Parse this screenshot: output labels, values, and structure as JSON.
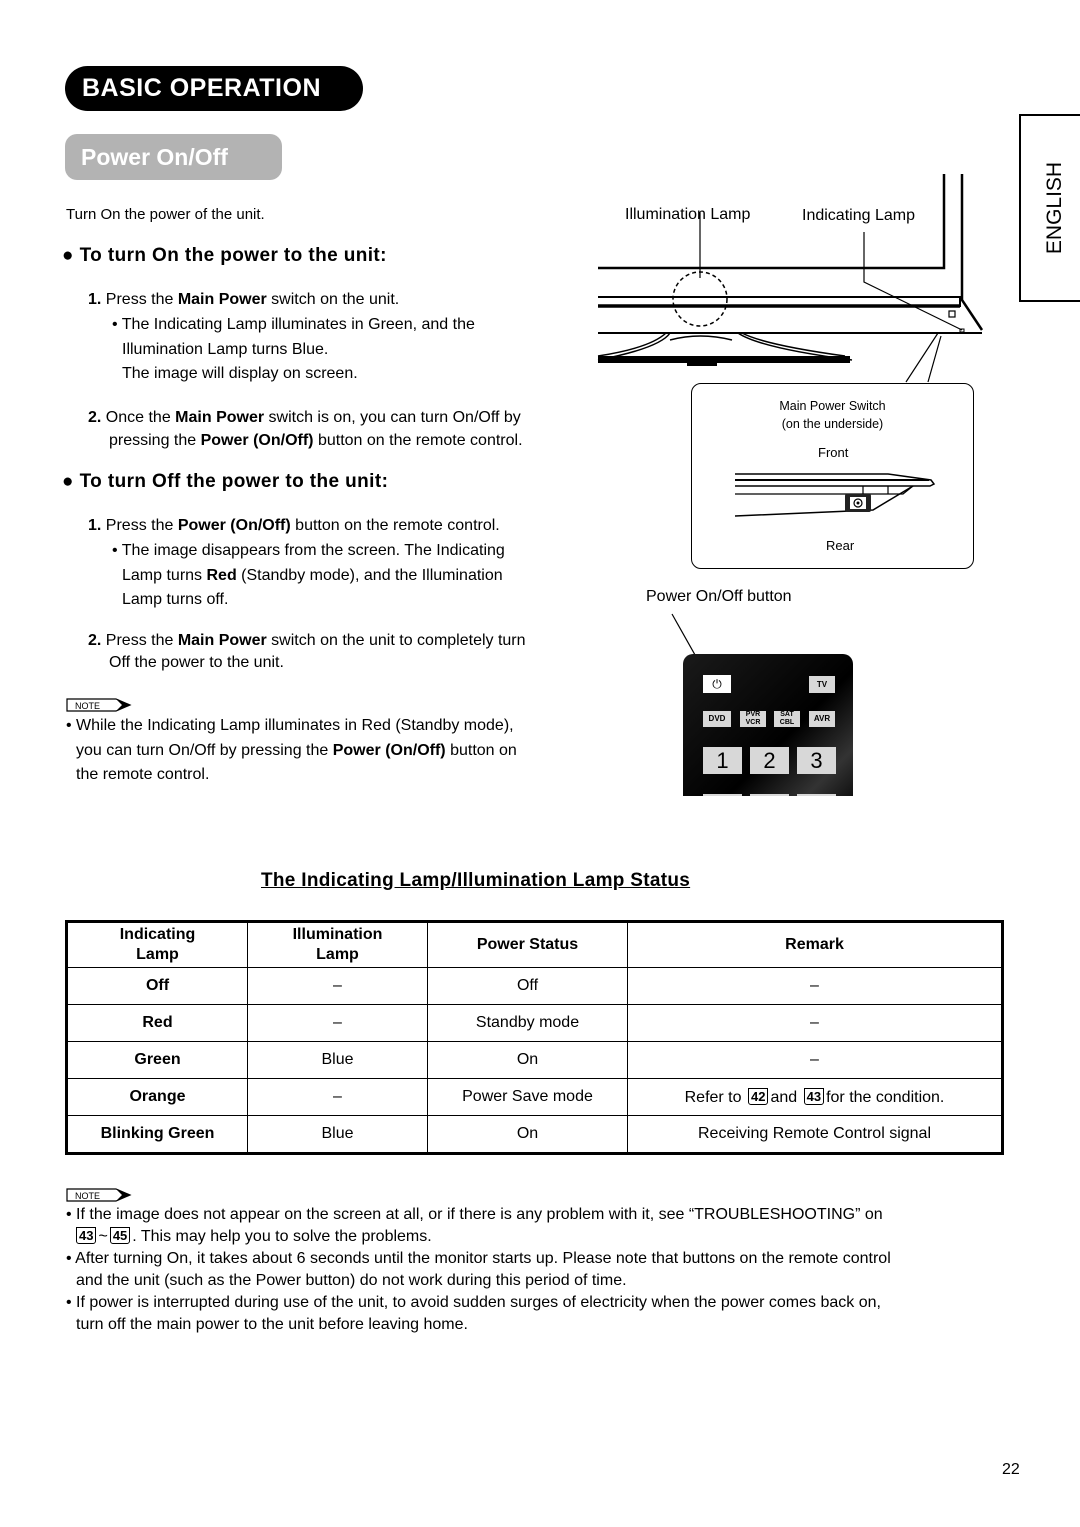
{
  "header": {
    "section_title": "BASIC OPERATION",
    "subsection_title": "Power On/Off",
    "language_tab": "ENGLISH"
  },
  "intro": "Turn On the power of the unit.",
  "turn_on": {
    "heading": "To turn On the power to the unit:",
    "step1_num": "1.",
    "step1_pre": "Press the ",
    "step1_bold": "Main Power",
    "step1_post": " switch on the unit.",
    "step1_bullet_line1": "The Indicating Lamp illuminates in Green, and the",
    "step1_bullet_line2": "Illumination Lamp turns Blue.",
    "step1_bullet_line3": "The image will display on screen.",
    "step2_num": "2.",
    "step2_pre": "Once the ",
    "step2_bold1": "Main Power",
    "step2_mid": " switch is on, you can turn On/Off by",
    "step2_line2_pre": "pressing the ",
    "step2_bold2": "Power (On/Off)",
    "step2_line2_post": " button on the remote control."
  },
  "turn_off": {
    "heading": "To turn Off the power to the unit:",
    "step1_num": "1.",
    "step1_pre": "Press the ",
    "step1_bold": "Power (On/Off)",
    "step1_post": " button on the remote control.",
    "step1_bullet_line1": "The image disappears from the screen. The Indicating",
    "step1_bullet_line2_pre": "Lamp turns ",
    "step1_bullet_line2_bold": "Red",
    "step1_bullet_line2_post": " (Standby mode), and the Illumination",
    "step1_bullet_line3": "Lamp turns off.",
    "step2_num": "2.",
    "step2_pre": "Press the ",
    "step2_bold": "Main Power",
    "step2_post": " switch on the unit to completely turn",
    "step2_line2": "Off the power to the unit."
  },
  "note1": {
    "tag": "NOTE",
    "line1": "While the Indicating Lamp illuminates in Red (Standby mode),",
    "line2_pre": "you can turn On/Off by pressing the ",
    "line2_bold": "Power (On/Off)",
    "line2_post": " button on",
    "line3": "the remote control."
  },
  "diagram": {
    "illumination_lamp_label": "Illumination Lamp",
    "indicating_lamp_label": "Indicating Lamp",
    "callout_title_line1": "Main Power Switch",
    "callout_title_line2": "(on the underside)",
    "front_label": "Front",
    "rear_label": "Rear",
    "remote_label": "Power On/Off button",
    "remote_buttons": {
      "power": "⏻",
      "tv": "TV",
      "dvd": "DVD",
      "pvr_vcr": "PVR VCR",
      "sat_cbl": "SAT CBL",
      "avr": "AVR",
      "n1": "1",
      "n2": "2",
      "n3": "3"
    }
  },
  "table": {
    "title": "The Indicating Lamp/Illumination Lamp Status",
    "headers": [
      "Indicating Lamp",
      "Illumination Lamp",
      "Power Status",
      "Remark"
    ],
    "rows": [
      [
        "Off",
        "–",
        "Off",
        "–"
      ],
      [
        "Red",
        "–",
        "Standby mode",
        "–"
      ],
      [
        "Green",
        "Blue",
        "On",
        "–"
      ],
      [
        "Orange",
        "–",
        "Power Save mode",
        "Refer to 42 and 43 for the condition."
      ],
      [
        "Blinking Green",
        "Blue",
        "On",
        "Receiving Remote Control signal"
      ]
    ],
    "remark_refer_pre": "Refer to",
    "remark_refer_page1": "42",
    "remark_refer_mid": "and",
    "remark_refer_page2": "43",
    "remark_refer_post": "for the condition."
  },
  "note2": {
    "tag": "NOTE",
    "bullet1_line1": "If the image does not appear on the screen at all, or if there is any problem with it, see “TROUBLESHOOTING” on",
    "bullet1_page_from": "43",
    "bullet1_page_sep": "~",
    "bullet1_page_to": "45",
    "bullet1_line2": ". This may help you to solve the problems.",
    "bullet2_line1": "After turning On, it takes about 6 seconds until the monitor starts up. Please note that buttons on the remote control",
    "bullet2_line2": "and the unit (such as the Power button) do not work during this period of time.",
    "bullet3_line1": "If power is interrupted during use of the unit, to avoid sudden surges of electricity when the power comes back on,",
    "bullet3_line2": "turn off the main power to the unit before leaving home."
  },
  "page_number": "22"
}
